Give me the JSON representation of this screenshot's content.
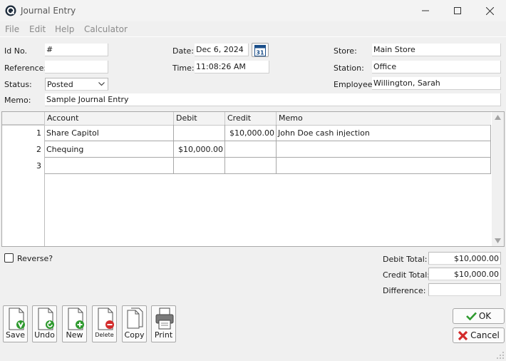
{
  "window": {
    "title": "Journal Entry"
  },
  "menu": [
    "File",
    "Edit",
    "Help",
    "Calculator"
  ],
  "form": {
    "id_label": "Id No.",
    "id_value": "#",
    "reference_label": "Reference:",
    "reference_value": "",
    "status_label": "Status:",
    "status_value": "Posted",
    "memo_label": "Memo:",
    "memo_value": "Sample Journal Entry",
    "date_label": "Date:",
    "date_value": "Dec 6, 2024",
    "calendar_day": "31",
    "time_label": "Time:",
    "time_value": "11:08:26 AM",
    "store_label": "Store:",
    "store_value": "Main Store",
    "station_label": "Station:",
    "station_value": "Office",
    "employee_label": "Employee:",
    "employee_value": "Willington, Sarah"
  },
  "table": {
    "columns": [
      "Account",
      "Debit",
      "Credit",
      "Memo"
    ],
    "rows": [
      {
        "num": "1",
        "account": "Share Capitol",
        "debit": "",
        "credit": "$10,000.00",
        "memo": "John Doe cash injection"
      },
      {
        "num": "2",
        "account": "Chequing",
        "debit": "$10,000.00",
        "credit": "",
        "memo": ""
      },
      {
        "num": "3",
        "account": "",
        "debit": "",
        "credit": "",
        "memo": ""
      }
    ]
  },
  "reverse_label": "Reverse?",
  "totals": {
    "debit_label": "Debit Total:",
    "debit_value": "$10,000.00",
    "credit_label": "Credit Total:",
    "credit_value": "$10,000.00",
    "difference_label": "Difference:",
    "difference_value": ""
  },
  "toolbar": {
    "save": "Save",
    "undo": "Undo",
    "new": "New",
    "delete": "Delete",
    "copy": "Copy",
    "print": "Print"
  },
  "dialog": {
    "ok": "OK",
    "cancel": "Cancel"
  },
  "colors": {
    "green": "#2e9a2e",
    "red": "#d32b2b",
    "icon_blue": "#1b4f8a"
  }
}
